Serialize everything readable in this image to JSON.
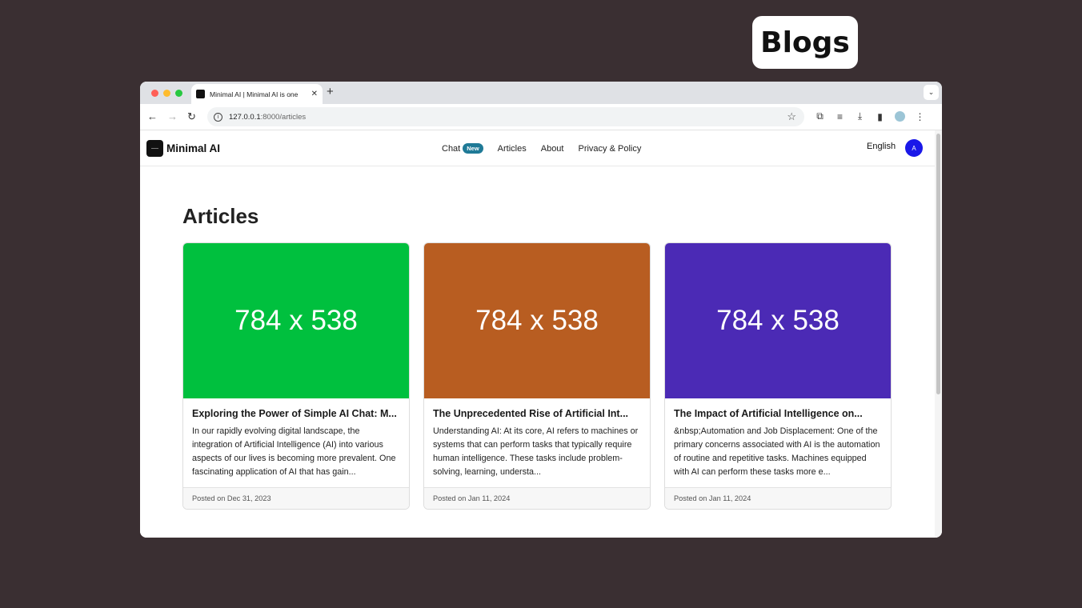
{
  "overlay": {
    "label": "Blogs"
  },
  "browser": {
    "tab_title": "Minimal AI | Minimal AI is one",
    "tab_close": "✕",
    "new_tab": "+",
    "tab_menu": "⌄",
    "url_host": "127.0.0.1",
    "url_path": ":8000/articles"
  },
  "site": {
    "brand": "Minimal AI",
    "nav": {
      "chat": "Chat",
      "chat_badge": "New",
      "articles": "Articles",
      "about": "About",
      "privacy": "Privacy & Policy"
    },
    "language": "English",
    "avatar_initial": "A"
  },
  "page": {
    "heading": "Articles"
  },
  "articles": [
    {
      "image_text": "784 x 538",
      "image_color": "#00c03e",
      "title": "Exploring the Power of Simple AI Chat: M...",
      "excerpt": "In our rapidly evolving digital landscape, the integration of Artificial Intelligence (AI) into various aspects of our lives is becoming more prevalent. One fascinating application of AI that has gain...",
      "posted": "Posted on Dec 31, 2023"
    },
    {
      "image_text": "784 x 538",
      "image_color": "#b85d21",
      "title": "The Unprecedented Rise of Artificial Int...",
      "excerpt": "Understanding AI: At its core, AI refers to machines or systems that can perform tasks that typically require human intelligence. These tasks include problem-solving, learning, understa...",
      "posted": "Posted on Jan 11, 2024"
    },
    {
      "image_text": "784 x 538",
      "image_color": "#4b2ab5",
      "title": "The Impact of Artificial Intelligence on...",
      "excerpt": "&nbsp;Automation and Job Displacement: One of the primary concerns associated with AI is the automation of routine and repetitive tasks. Machines equipped with AI can perform these tasks more e...",
      "posted": "Posted on Jan 11, 2024"
    }
  ]
}
